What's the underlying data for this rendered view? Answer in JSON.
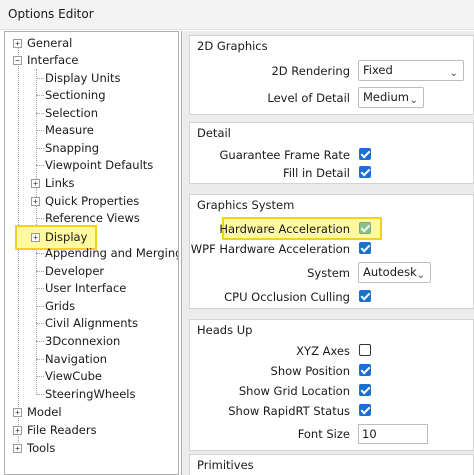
{
  "window": {
    "title": "Options Editor"
  },
  "tree": {
    "items": [
      {
        "label": "General",
        "expander": "+"
      },
      {
        "label": "Interface",
        "expander": "−"
      },
      {
        "label": "Display Units"
      },
      {
        "label": "Sectioning"
      },
      {
        "label": "Selection"
      },
      {
        "label": "Measure"
      },
      {
        "label": "Snapping"
      },
      {
        "label": "Viewpoint Defaults"
      },
      {
        "label": "Links",
        "expander": "+"
      },
      {
        "label": "Quick Properties",
        "expander": "+"
      },
      {
        "label": "Reference Views"
      },
      {
        "label": "Display",
        "expander": "+",
        "selected": true
      },
      {
        "label": "Appending and Merging"
      },
      {
        "label": "Developer"
      },
      {
        "label": "User Interface"
      },
      {
        "label": "Grids"
      },
      {
        "label": "Civil Alignments"
      },
      {
        "label": "3Dconnexion"
      },
      {
        "label": "Navigation"
      },
      {
        "label": "ViewCube"
      },
      {
        "label": "SteeringWheels"
      },
      {
        "label": "Model",
        "expander": "+"
      },
      {
        "label": "File Readers",
        "expander": "+"
      },
      {
        "label": "Tools",
        "expander": "+"
      }
    ]
  },
  "groups": {
    "graphics2d": {
      "title": "2D Graphics",
      "rendering_label": "2D Rendering",
      "rendering_value": "Fixed",
      "lod_label": "Level of Detail",
      "lod_value": "Medium"
    },
    "detail": {
      "title": "Detail",
      "guarantee_label": "Guarantee Frame Rate",
      "guarantee_checked": true,
      "fill_label": "Fill in Detail",
      "fill_checked": true
    },
    "graphics_system": {
      "title": "Graphics System",
      "hw_label": "Hardware Acceleration",
      "hw_checked": true,
      "wpf_label": "WPF Hardware Acceleration",
      "wpf_checked": true,
      "system_label": "System",
      "system_value": "Autodesk",
      "cpu_label": "CPU Occlusion Culling",
      "cpu_checked": true
    },
    "heads_up": {
      "title": "Heads Up",
      "xyz_label": "XYZ Axes",
      "xyz_checked": false,
      "pos_label": "Show Position",
      "pos_checked": true,
      "grid_label": "Show Grid Location",
      "grid_checked": true,
      "rapid_label": "Show RapidRT Status",
      "rapid_checked": true,
      "font_label": "Font Size",
      "font_value": "10"
    },
    "primitives": {
      "title": "Primitives"
    }
  },
  "colors": {
    "accent": "#1a6fcf",
    "highlight_fill": "#fff9a0",
    "highlight_border": "#f2d21b"
  }
}
